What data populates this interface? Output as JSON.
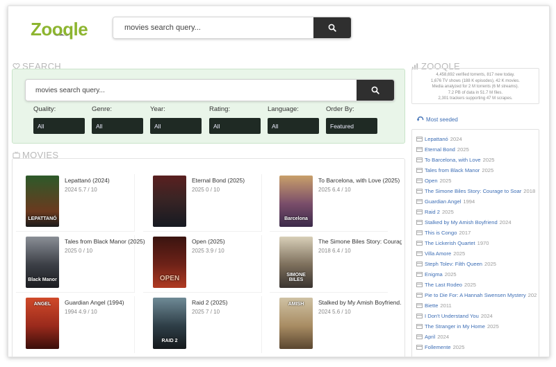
{
  "brand": {
    "logo_text": "Zooqle"
  },
  "header": {
    "search_placeholder": "movies search query..."
  },
  "search_section": {
    "heading": "SEARCH",
    "search_placeholder": "movies search query...",
    "filters": [
      {
        "label": "Quality:",
        "value": "All"
      },
      {
        "label": "Genre:",
        "value": "All"
      },
      {
        "label": "Year:",
        "value": "All"
      },
      {
        "label": "Rating:",
        "value": "All"
      },
      {
        "label": "Language:",
        "value": "All"
      },
      {
        "label": "Order By:",
        "value": "Featured"
      }
    ]
  },
  "movies_section": {
    "heading": "MOVIES",
    "movies": [
      {
        "title": "Lepattanó (2024)",
        "meta": "2024 5.7 / 10",
        "poster_text": "LEPATTANÓ",
        "poster_color": "#6b3a1f"
      },
      {
        "title": "Eternal Bond (2025)",
        "meta": "2025 0 / 10",
        "poster_text": "",
        "poster_color": "#3a2424"
      },
      {
        "title": "To Barcelona, with Love (2025)",
        "meta": "2025 6.4 / 10",
        "poster_text": "Barcelona",
        "poster_color": "#7a4d6a"
      },
      {
        "title": "Tales from Black Manor (2025)",
        "meta": "2025 0 / 10",
        "poster_text": "Black Manor",
        "poster_color": "#3c3f46"
      },
      {
        "title": "Open (2025)",
        "meta": "2025 3.9 / 10",
        "poster_text": "OPEN",
        "poster_color": "#6e2218"
      },
      {
        "title": "The Simone Biles Story: Courag...",
        "meta": "2018 6.4 / 10",
        "poster_text": "SIMONE BILES",
        "poster_color": "#7d6f5c"
      },
      {
        "title": "Guardian Angel (1994)",
        "meta": "1994 4.9 / 10",
        "poster_text": "ANGEL",
        "poster_color": "#9a2a1c"
      },
      {
        "title": "Raid 2 (2025)",
        "meta": "2025 7 / 10",
        "poster_text": "RAID 2",
        "poster_color": "#2e3e47"
      },
      {
        "title": "Stalked by My Amish Boyfriend...",
        "meta": "2024 5.6 / 10",
        "poster_text": "AMISH",
        "poster_color": "#a88c63"
      }
    ]
  },
  "right_column": {
    "heading": "ZOOQLE",
    "stats": [
      "4,458,692 verified torrents, 817 new today.",
      "1,676 TV shows (188 K episodes), 42 K movies.",
      "Media analyzed for 2 M torrents (6 M streams).",
      "7.2 PB of data in 51.7 M files.",
      "2,301 trackers  supporting 47 M scrapes."
    ],
    "most_seeded_label": "Most seeded",
    "most_seeded": [
      {
        "title": "Lepattanó",
        "year": "2024"
      },
      {
        "title": "Eternal Bond",
        "year": "2025"
      },
      {
        "title": "To Barcelona, with Love",
        "year": "2025"
      },
      {
        "title": "Tales from Black Manor",
        "year": "2025"
      },
      {
        "title": "Open",
        "year": "2025"
      },
      {
        "title": "The Simone Biles Story: Courage to Soar",
        "year": "2018"
      },
      {
        "title": "Guardian Angel",
        "year": "1994"
      },
      {
        "title": "Raid 2",
        "year": "2025"
      },
      {
        "title": "Stalked by My Amish Boyfriend",
        "year": "2024"
      },
      {
        "title": "This is Congo",
        "year": "2017"
      },
      {
        "title": "The Lickerish Quartet",
        "year": "1970"
      },
      {
        "title": "Villa Amore",
        "year": "2025"
      },
      {
        "title": "Steph Tolev: Filth Queen",
        "year": "2025"
      },
      {
        "title": "Enigma",
        "year": "2025"
      },
      {
        "title": "The Last Rodeo",
        "year": "2025"
      },
      {
        "title": "Pie to Die For: A Hannah Swensen Mystery",
        "year": "202"
      },
      {
        "title": "Biette",
        "year": "2011"
      },
      {
        "title": "I Don't Understand You",
        "year": "2024"
      },
      {
        "title": "The Stranger in My Home",
        "year": "2025"
      },
      {
        "title": "April",
        "year": "2024"
      },
      {
        "title": "Follemente",
        "year": "2025"
      }
    ]
  },
  "colors": {
    "brand_green": "#8db530",
    "link_blue": "#3d6eb5",
    "dark_button": "#2f2f2f",
    "panel_green": "#e9f5e9"
  },
  "icons": {
    "search": "search-icon",
    "heart": "heart-icon",
    "tv": "tv-icon",
    "chart": "chart-icon",
    "refresh": "refresh-icon",
    "film": "film-icon"
  }
}
